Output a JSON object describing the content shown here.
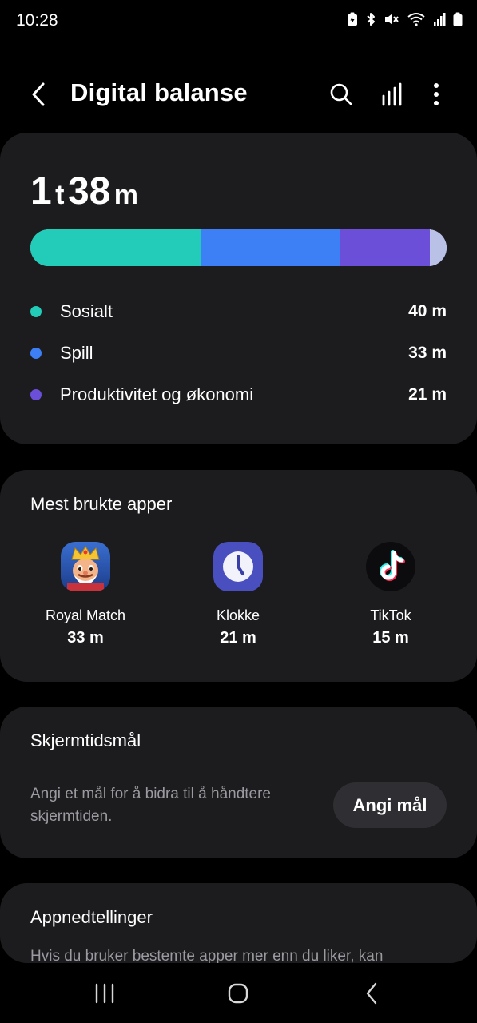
{
  "status_bar": {
    "time": "10:28"
  },
  "header": {
    "title": "Digital balanse",
    "back_icon": "back-arrow-icon",
    "search_icon": "search-icon",
    "stats_icon": "bar-chart-icon",
    "more_icon": "more-vert-icon"
  },
  "summary": {
    "total_hours": "1",
    "hours_unit": "t",
    "total_minutes": "38",
    "minutes_unit": "m",
    "segments": [
      {
        "minutes": 40,
        "color": "#22ccb8"
      },
      {
        "minutes": 33,
        "color": "#3d7ff5"
      },
      {
        "minutes": 21,
        "color": "#6b4fd8"
      },
      {
        "minutes": 4,
        "color": "#b9c2e6"
      }
    ],
    "categories": [
      {
        "label": "Sosialt",
        "value": "40 m",
        "color": "#22ccb8"
      },
      {
        "label": "Spill",
        "value": "33 m",
        "color": "#3d7ff5"
      },
      {
        "label": "Produktivitet og økonomi",
        "value": "21 m",
        "color": "#6b4fd8"
      }
    ]
  },
  "most_used": {
    "title": "Mest brukte apper",
    "apps": [
      {
        "name": "Royal Match",
        "time": "33 m",
        "icon": "royal-match-icon"
      },
      {
        "name": "Klokke",
        "time": "21 m",
        "icon": "clock-icon"
      },
      {
        "name": "TikTok",
        "time": "15 m",
        "icon": "tiktok-icon"
      }
    ]
  },
  "screen_time_goal": {
    "title": "Skjermtidsmål",
    "description": "Angi et mål for å bidra til å håndtere skjermtiden.",
    "button_label": "Angi mål"
  },
  "app_timers": {
    "title": "Appnedtellinger",
    "description": "Hvis du bruker bestemte apper mer enn du liker, kan"
  }
}
